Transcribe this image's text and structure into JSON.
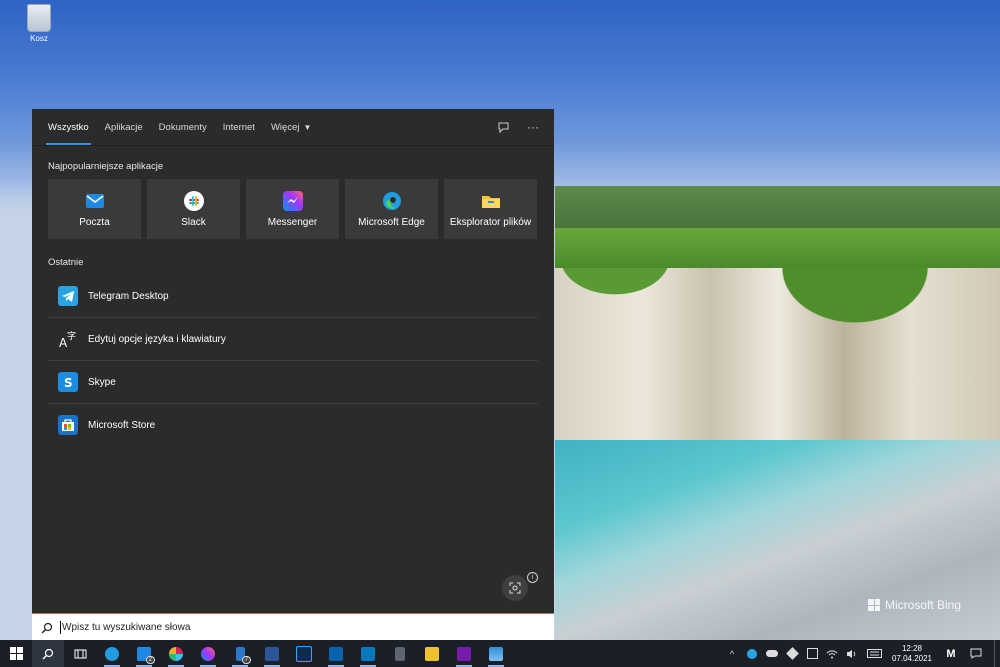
{
  "desktop": {
    "recycle_bin_label": "Kosz",
    "watermark": "Microsoft Bing"
  },
  "search_panel": {
    "tabs": [
      {
        "label": "Wszystko",
        "active": true
      },
      {
        "label": "Aplikacje",
        "active": false
      },
      {
        "label": "Dokumenty",
        "active": false
      },
      {
        "label": "Internet",
        "active": false
      },
      {
        "label": "Więcej",
        "active": false,
        "dropdown": true
      }
    ],
    "top_apps_title": "Najpopularniejsze aplikacje",
    "top_apps": [
      {
        "label": "Poczta",
        "icon": "mail-icon",
        "color": "#1e88e5"
      },
      {
        "label": "Slack",
        "icon": "slack-icon",
        "color": "#ffffff"
      },
      {
        "label": "Messenger",
        "icon": "messenger-icon",
        "color": "#a24dff"
      },
      {
        "label": "Microsoft Edge",
        "icon": "edge-icon",
        "color": "#1f9de0"
      },
      {
        "label": "Eksplorator plików",
        "icon": "folder-icon",
        "color": "#f2c12e"
      }
    ],
    "recent_title": "Ostatnie",
    "recent": [
      {
        "label": "Telegram Desktop",
        "icon": "telegram-icon",
        "color": "#2aa3e0"
      },
      {
        "label": "Edytuj opcje języka i klawiatury",
        "icon": "language-icon",
        "color": "#2b2b2b"
      },
      {
        "label": "Skype",
        "icon": "skype-icon",
        "color": "#1a8ee1"
      },
      {
        "label": "Microsoft Store",
        "icon": "store-icon",
        "color": "#1a73c9"
      }
    ]
  },
  "search_box": {
    "placeholder": "Wpisz tu wyszukiwane słowa"
  },
  "taskbar": {
    "pinned": [
      {
        "name": "edge",
        "color": "#1f9de0"
      },
      {
        "name": "mail",
        "color": "#1e88e5",
        "badge": "2"
      },
      {
        "name": "slack",
        "color": "#e01e5a"
      },
      {
        "name": "messenger",
        "color": "#a24dff"
      },
      {
        "name": "phone",
        "color": "#2f78c9",
        "badge": "7"
      },
      {
        "name": "word",
        "color": "#2b579a"
      },
      {
        "name": "photoshop",
        "color": "#0f2a47"
      },
      {
        "name": "outlook",
        "color": "#0a64ad"
      },
      {
        "name": "trello",
        "color": "#0079bf"
      },
      {
        "name": "calculator",
        "color": "#5b6670"
      },
      {
        "name": "explorer",
        "color": "#f2c12e"
      },
      {
        "name": "onenote",
        "color": "#7719aa"
      },
      {
        "name": "photos",
        "color": "#2f8fd6"
      }
    ],
    "clock_time": "12:28",
    "clock_date": "07.04.2021"
  }
}
